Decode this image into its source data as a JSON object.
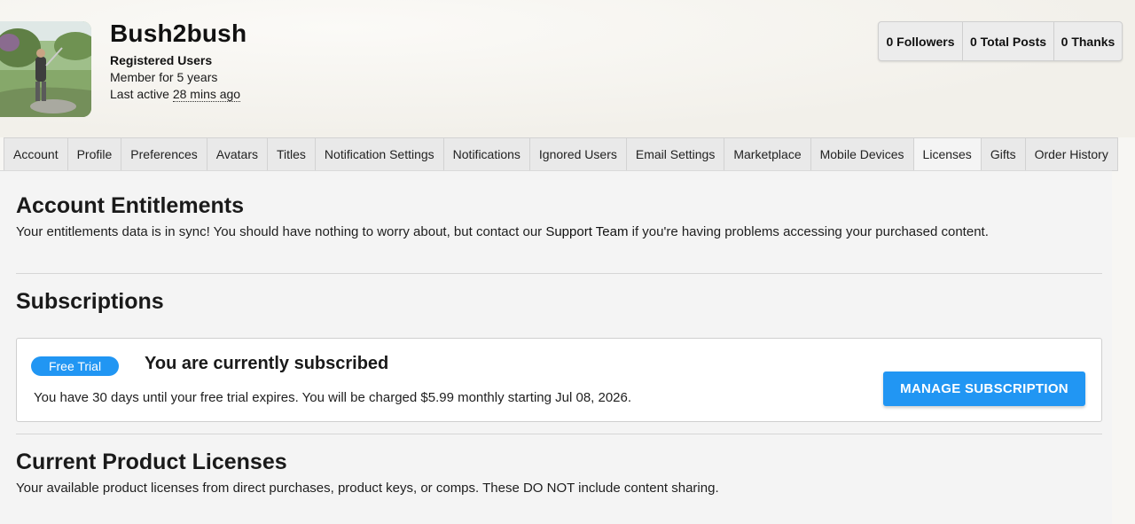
{
  "profile": {
    "username": "Bush2bush",
    "group": "Registered Users",
    "member_for": "Member for 5 years",
    "last_active_label": "Last active ",
    "last_active_time": "28 mins ago"
  },
  "stats": [
    {
      "label": "0 Followers"
    },
    {
      "label": "0 Total Posts"
    },
    {
      "label": "0 Thanks"
    }
  ],
  "tabs": [
    {
      "label": "Account"
    },
    {
      "label": "Profile"
    },
    {
      "label": "Preferences"
    },
    {
      "label": "Avatars"
    },
    {
      "label": "Titles"
    },
    {
      "label": "Notification Settings"
    },
    {
      "label": "Notifications"
    },
    {
      "label": "Ignored Users"
    },
    {
      "label": "Email Settings"
    },
    {
      "label": "Marketplace"
    },
    {
      "label": "Mobile Devices"
    },
    {
      "label": "Licenses"
    },
    {
      "label": "Gifts"
    },
    {
      "label": "Order History"
    }
  ],
  "active_tab": "Licenses",
  "entitlements": {
    "title": "Account Entitlements",
    "text_before": "Your entitlements data is in sync! You should have nothing to worry about, but contact our ",
    "link": "Support Team",
    "text_after": " if you're having problems accessing your purchased content."
  },
  "subscriptions": {
    "title": "Subscriptions",
    "badge": "Free Trial",
    "status": "You are currently subscribed",
    "description": "You have 30 days until your free trial expires. You will be charged $5.99 monthly starting Jul 08, 2026.",
    "button": "MANAGE SUBSCRIPTION"
  },
  "licenses": {
    "title": "Current Product Licenses",
    "description": "Your available product licenses from direct purchases, product keys, or comps. These DO NOT include content sharing."
  },
  "colors": {
    "accent": "#2196f3",
    "page_bg": "#f4f4f4"
  }
}
